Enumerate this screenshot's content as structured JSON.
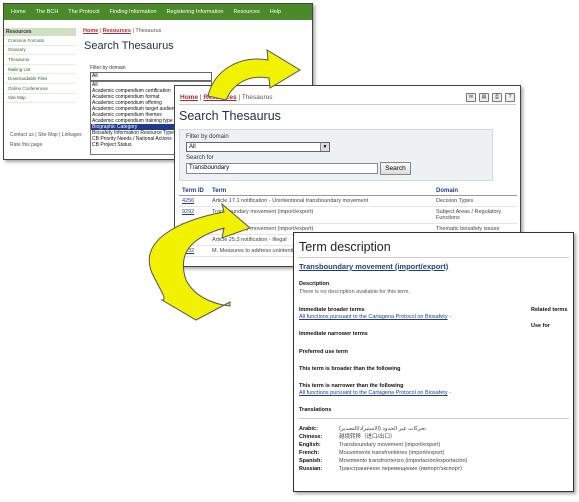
{
  "win1": {
    "nav": [
      "Home",
      "The BCH",
      "The Protocol",
      "Finding Information",
      "Registering Information",
      "Resources",
      "Help"
    ],
    "sidebar": {
      "heading": "Resources",
      "items": [
        "Common Formats",
        "Glossary",
        "Thesaurus",
        "Mailing List",
        "Downloadable Files",
        "Online Conferences",
        "Site Map"
      ]
    },
    "footer": {
      "links": "Contact us | Site Map | Linkages",
      "rate": "Rate this page"
    },
    "breadcrumb": {
      "home": "Home",
      "sep1": " | ",
      "resources": "Resources",
      "sep2": " | ",
      "current": "Thesaurus"
    },
    "title": "Search Thesaurus",
    "filter_label": "Filter by domain",
    "filter_value": "All",
    "dropdown_options": [
      "All",
      "Academic compendium certification",
      "Academic compendium format",
      "Academic compendium offering",
      "Academic compendium target audience",
      "Academic compendium themes",
      "Academic compendium training type",
      "Biographic Category",
      "Biosafety Information Resource Type",
      "CB Priority Needs / National Actions",
      "CB Project Status"
    ],
    "dropdown_selected_index": 7
  },
  "win2": {
    "breadcrumb": {
      "home": "Home",
      "sep1": " | ",
      "resources": "Resources",
      "sep2": " | ",
      "current": "Thesaurus"
    },
    "title": "Search Thesaurus",
    "filter_label": "Filter by domain",
    "filter_value": "All",
    "search_label": "Search for",
    "search_value": "Transboundary",
    "search_button": "Search",
    "columns": [
      "Term ID",
      "Term",
      "Domain"
    ],
    "rows": [
      {
        "id": "4256",
        "term": "Article 17.1 notification - Unintentional transboundary movement",
        "domain": "Decision Types"
      },
      {
        "id": "9292",
        "term": "Transboundary movement (import/export)",
        "domain": "Subject Areas / Regulatory Functions"
      },
      {
        "id": "",
        "term": "Transboundary movement (import/export)",
        "domain": "Thematic biosafety issues"
      },
      {
        "id": "",
        "term": "Article 25.3 notification - Illegal",
        "domain": ""
      },
      {
        "id": "4732",
        "term": "M. Measures to address unintentional living modified organisms",
        "domain": ""
      }
    ]
  },
  "win3": {
    "title": "Term description",
    "term": "Transboundary movement (import/export)",
    "description_label": "Description",
    "description_text": "There is no description available for this term.",
    "broader_label": "Immediate broader terms",
    "broader_link": "All functions pursuant to the Cartagena Protocol on Biosafety",
    "related_label": "Related terms",
    "usefor_label": "Use for",
    "narrower_label": "Immediate narrower terms",
    "preferred_label": "Preferred use term",
    "broader_than_label": "This term is broader than the following",
    "narrower_than_label": "This term is narrower than the following",
    "narrower_than_link": "All functions pursuant to the Cartagena Protocol on Biosafety",
    "link_dash": "-",
    "translations_label": "Translations",
    "translations": [
      {
        "lang": "Arabic:",
        "value": "(تحركات عبر الحدود (الاستيراد/التصدير"
      },
      {
        "lang": "Chinese:",
        "value": "越境转移（进口/出口）"
      },
      {
        "lang": "English:",
        "value": "Transboundary movement (import/export)"
      },
      {
        "lang": "French:",
        "value": "Mouvements transfrontières (import/export)"
      },
      {
        "lang": "Spanish:",
        "value": "Movimiento transfronterizo (importación/exportación)"
      },
      {
        "lang": "Russian:",
        "value": "Трансграничное перемещение (импорт/экспорт)"
      }
    ]
  },
  "colors": {
    "nav_green": "#4b8a2a",
    "link_red": "#b2262e",
    "link_blue": "#1a3f8a",
    "arrow_yellow": "#f2f200"
  }
}
